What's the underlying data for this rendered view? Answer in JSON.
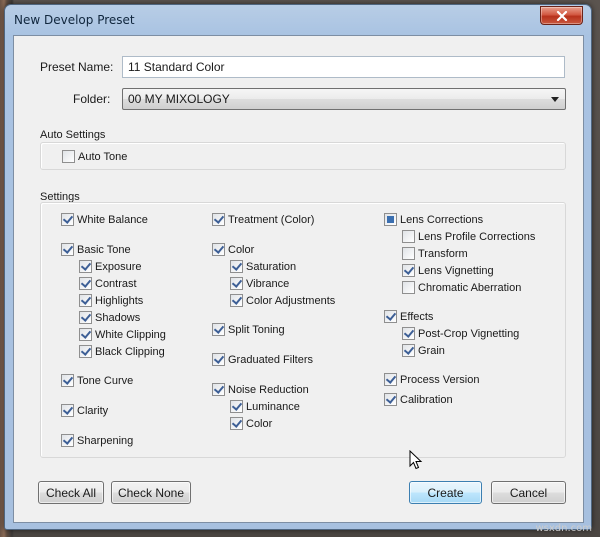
{
  "window": {
    "title": "New Develop Preset"
  },
  "preset_name": {
    "label": "Preset Name:",
    "value": "11 Standard Color"
  },
  "folder": {
    "label": "Folder:",
    "value": "00 MY MIXOLOGY"
  },
  "auto_settings": {
    "title": "Auto Settings",
    "auto_tone": "Auto Tone"
  },
  "settings": {
    "title": "Settings",
    "col1": {
      "white_balance": "White Balance",
      "basic_tone": "Basic Tone",
      "exposure": "Exposure",
      "contrast": "Contrast",
      "highlights": "Highlights",
      "shadows": "Shadows",
      "white_clipping": "White Clipping",
      "black_clipping": "Black Clipping",
      "tone_curve": "Tone Curve",
      "clarity": "Clarity",
      "sharpening": "Sharpening"
    },
    "col2": {
      "treatment": "Treatment (Color)",
      "color": "Color",
      "saturation": "Saturation",
      "vibrance": "Vibrance",
      "color_adjustments": "Color Adjustments",
      "split_toning": "Split Toning",
      "graduated_filters": "Graduated Filters",
      "noise_reduction": "Noise Reduction",
      "luminance": "Luminance",
      "nr_color": "Color"
    },
    "col3": {
      "lens_corrections": "Lens Corrections",
      "lens_profile": "Lens Profile Corrections",
      "transform": "Transform",
      "lens_vignetting": "Lens Vignetting",
      "chromatic_aberration": "Chromatic Aberration",
      "effects": "Effects",
      "post_crop": "Post-Crop Vignetting",
      "grain": "Grain",
      "process_version": "Process Version",
      "calibration": "Calibration"
    }
  },
  "buttons": {
    "check_all": "Check All",
    "check_none": "Check None",
    "create": "Create",
    "cancel": "Cancel"
  },
  "watermark": "wsxdn.com",
  "colors": {
    "accent": "#3c7fb1",
    "close": "#c9452c",
    "titlebar": "#aec6e3"
  }
}
